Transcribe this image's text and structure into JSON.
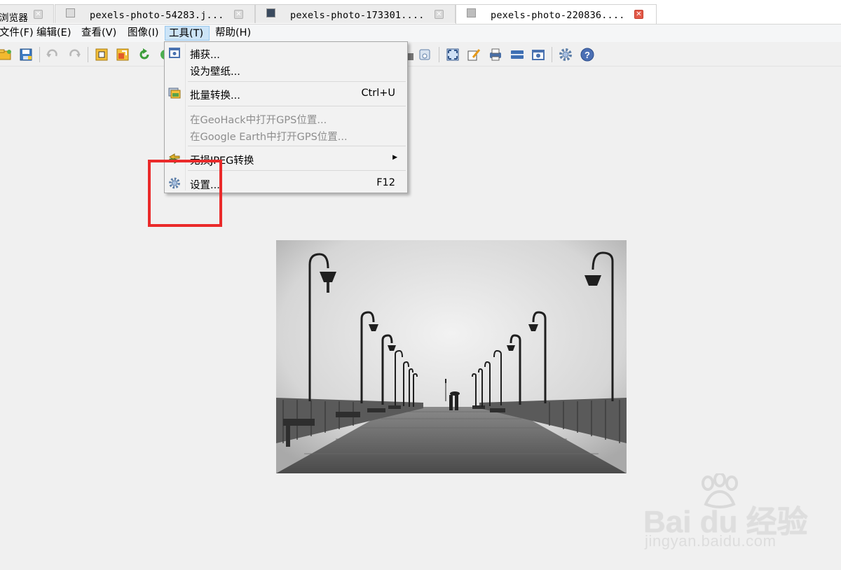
{
  "tabs": [
    {
      "label": "浏览器",
      "active": false
    },
    {
      "label": "pexels-photo-54283.j...",
      "active": false
    },
    {
      "label": "pexels-photo-173301....",
      "active": false
    },
    {
      "label": "pexels-photo-220836....",
      "active": true
    }
  ],
  "menubar": {
    "file": "文件(F)",
    "edit": "编辑(E)",
    "view": "查看(V)",
    "image": "图像(I)",
    "tools": "工具(T)",
    "help": "帮助(H)"
  },
  "tools_menu": {
    "capture": "捕获...",
    "set_wallpaper": "设为壁纸...",
    "batch_convert": "批量转换...",
    "batch_convert_shortcut": "Ctrl+U",
    "geohack": "在GeoHack中打开GPS位置...",
    "google_earth": "在Google Earth中打开GPS位置...",
    "lossless_jpeg": "无损JPEG转换",
    "settings": "设置...",
    "settings_shortcut": "F12"
  },
  "watermark": {
    "brand": "Bai du 经验",
    "url": "jingyan.baidu.com"
  },
  "icons": {
    "toolbar": [
      "folder-icon",
      "save-icon",
      "undo-icon",
      "redo-icon",
      "crop-icon",
      "resize-icon",
      "rotate-icon",
      "fit-icon",
      "edit-icon",
      "print-icon",
      "scan-icon",
      "capture-icon",
      "settings-gear-icon",
      "help-icon"
    ]
  },
  "colors": {
    "menu_highlight": "#cce4f7",
    "annotation_red": "#ea2a2a",
    "close_active": "#e35a49"
  }
}
